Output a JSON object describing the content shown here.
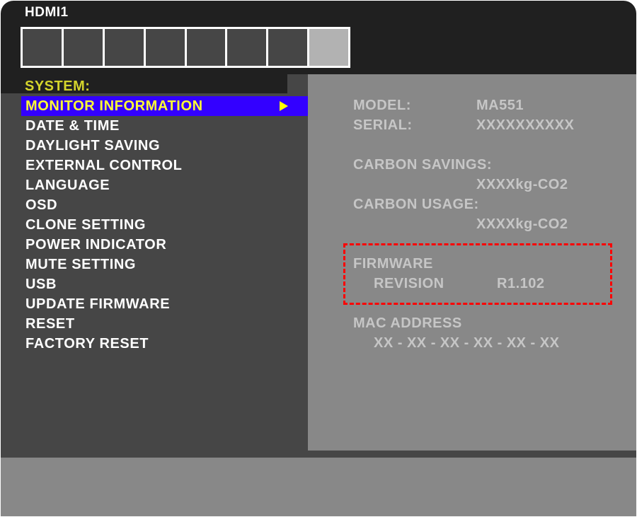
{
  "osd": {
    "input_name": "HDMI1",
    "tabs": [
      {
        "label": "",
        "selected": false
      },
      {
        "label": "",
        "selected": false
      },
      {
        "label": "",
        "selected": false
      },
      {
        "label": "",
        "selected": false
      },
      {
        "label": "",
        "selected": false
      },
      {
        "label": "",
        "selected": false
      },
      {
        "label": "",
        "selected": false
      },
      {
        "label": "",
        "selected": true
      }
    ],
    "section_title": "SYSTEM:",
    "menu": [
      {
        "label": "MONITOR INFORMATION",
        "selected": true,
        "icon": "arrow-right-icon"
      },
      {
        "label": "DATE & TIME"
      },
      {
        "label": "DAYLIGHT SAVING"
      },
      {
        "label": "EXTERNAL CONTROL"
      },
      {
        "label": "LANGUAGE"
      },
      {
        "label": "OSD"
      },
      {
        "label": "CLONE SETTING"
      },
      {
        "label": "POWER INDICATOR"
      },
      {
        "label": "MUTE SETTING"
      },
      {
        "label": "USB"
      },
      {
        "label": "UPDATE FIRMWARE"
      },
      {
        "label": "RESET"
      },
      {
        "label": "FACTORY RESET"
      }
    ],
    "info": {
      "model_label": "MODEL:",
      "model_value": "MA551",
      "serial_label": "SERIAL:",
      "serial_value": "XXXXXXXXXX",
      "carbon_savings_label": "CARBON SAVINGS:",
      "carbon_savings_value": "XXXXkg-CO2",
      "carbon_usage_label": "CARBON USAGE:",
      "carbon_usage_value": "XXXXkg-CO2",
      "firmware_label": "FIRMWARE",
      "revision_label": "REVISION",
      "revision_value": "R1.102",
      "mac_label": "MAC ADDRESS",
      "mac_value": "XX - XX - XX - XX - XX - XX"
    },
    "colors": {
      "highlight_bg": "#3300ff",
      "highlight_text": "#ffff33",
      "section_title": "#d4d42c",
      "annotation": "#ff0000"
    }
  }
}
